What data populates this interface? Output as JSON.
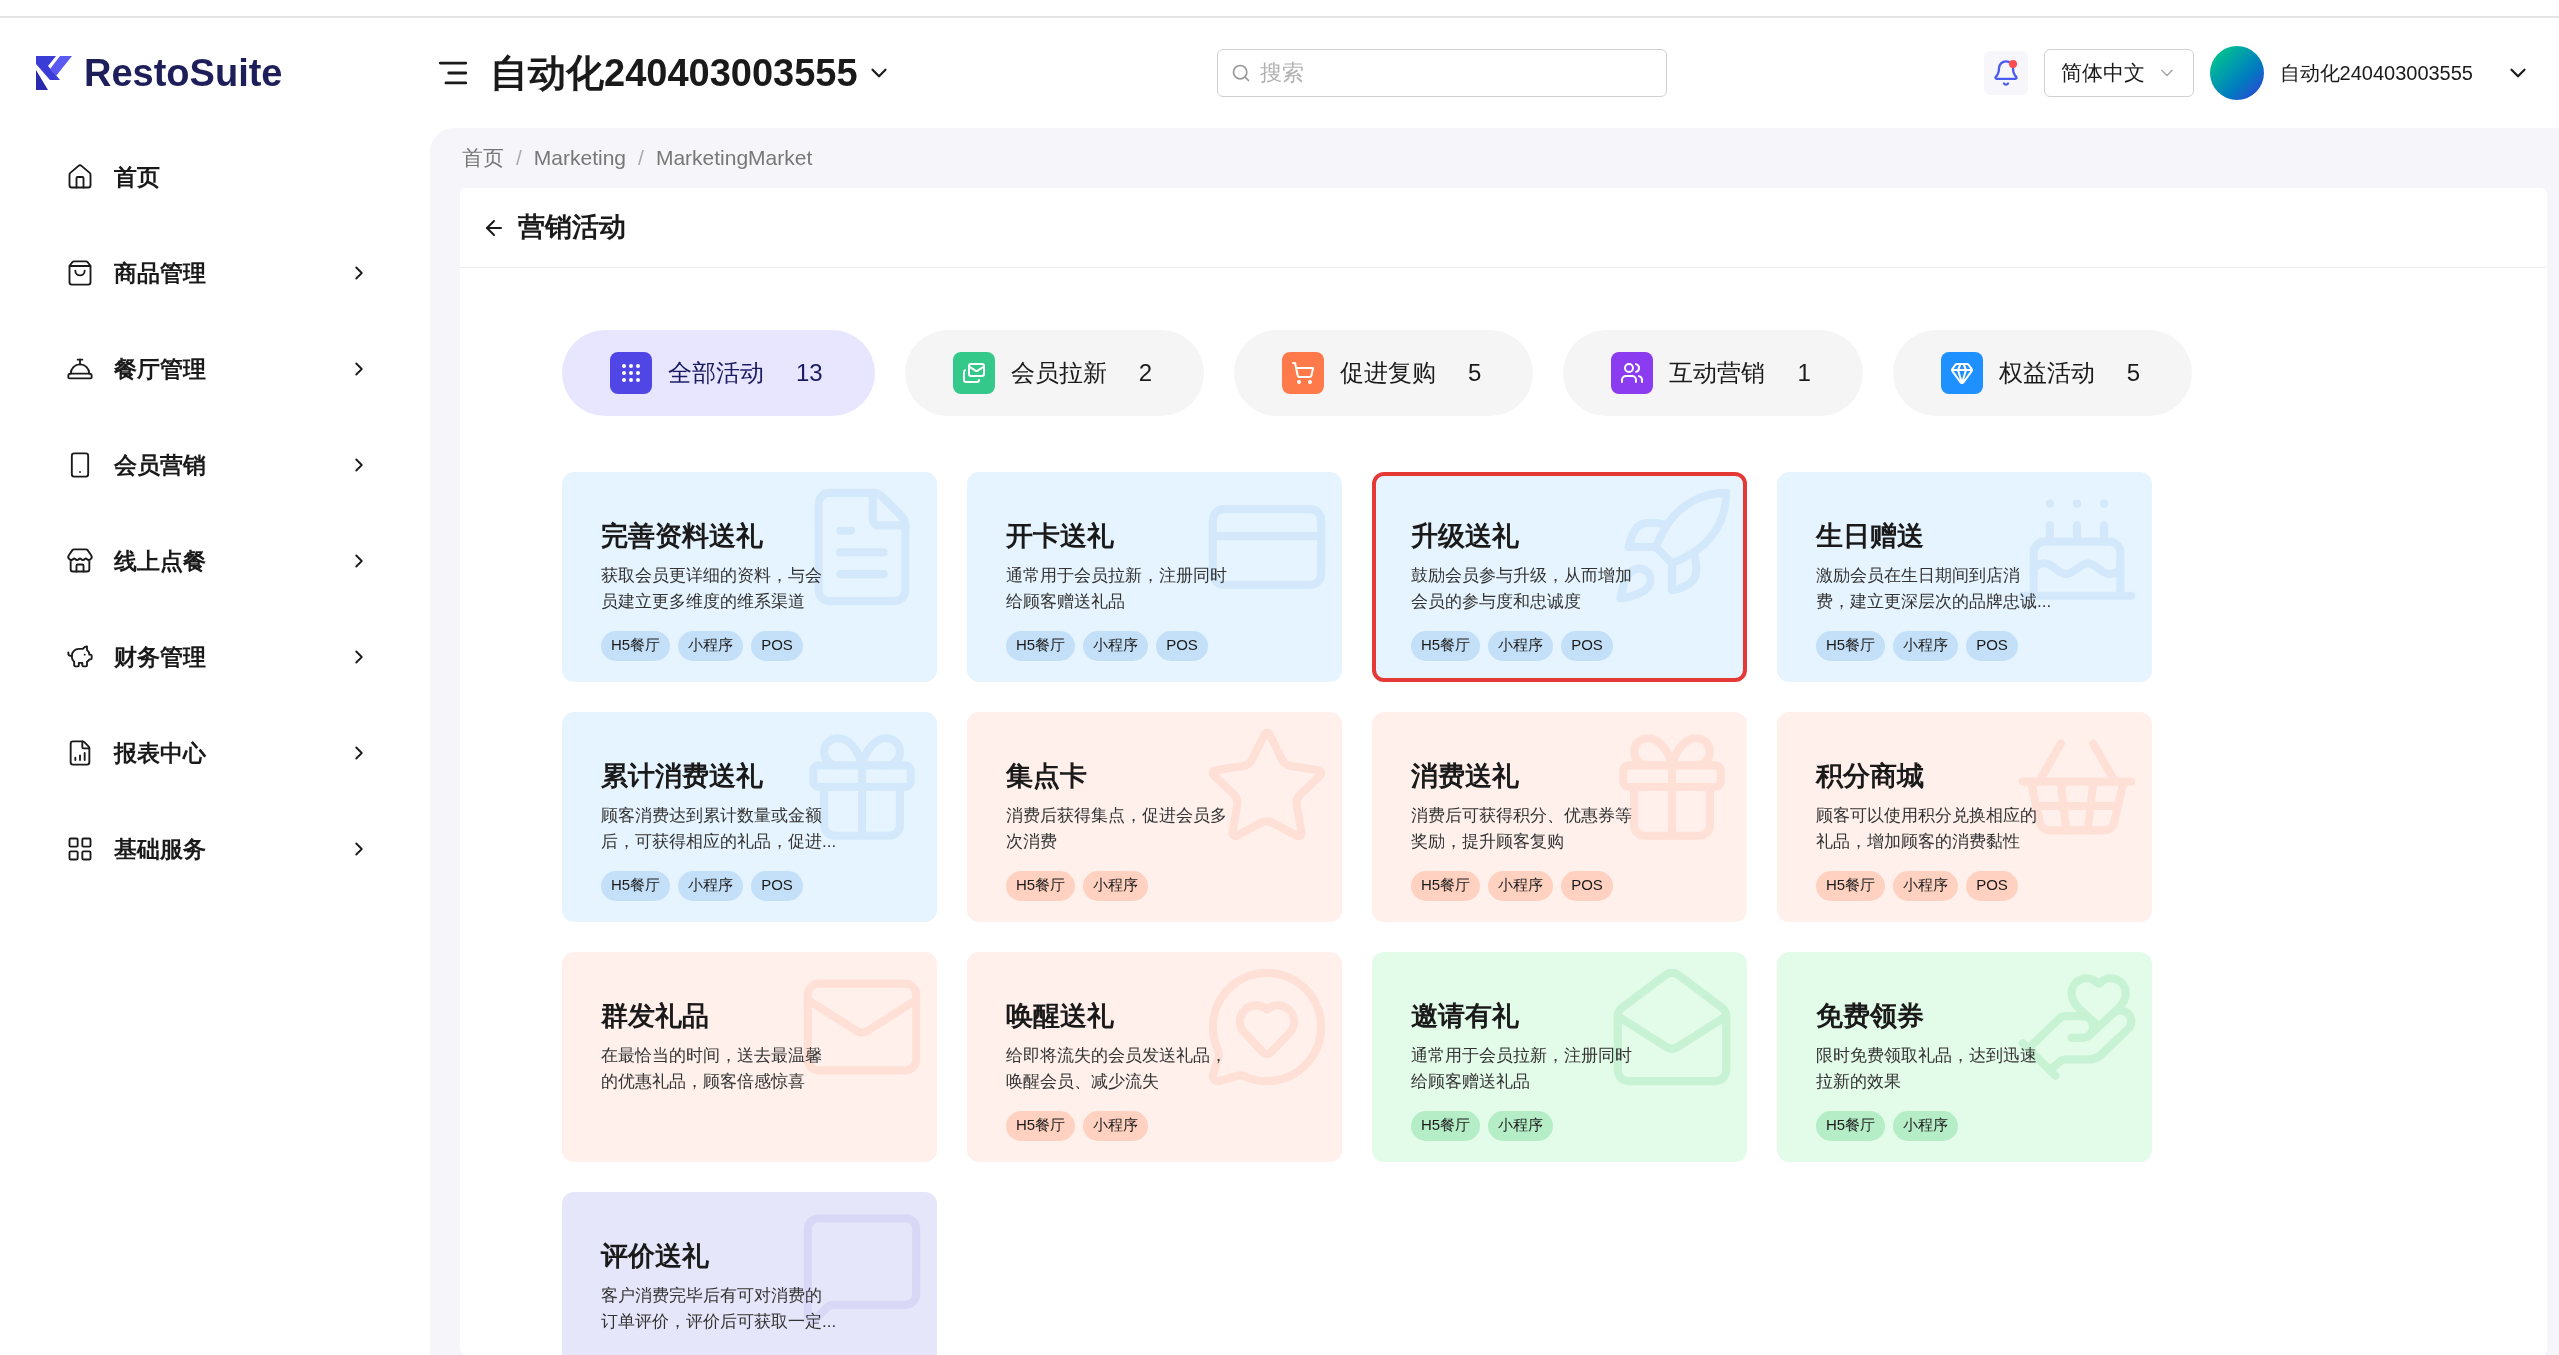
{
  "logo": "RestoSuite",
  "header": {
    "store": "自动化240403003555",
    "search": {
      "placeholder": "搜索"
    },
    "language": "简体中文",
    "user": "自动化240403003555",
    "notification_dot": true
  },
  "sidebar": {
    "items": [
      {
        "label": "首页",
        "has_children": false
      },
      {
        "label": "商品管理",
        "has_children": true
      },
      {
        "label": "餐厅管理",
        "has_children": true
      },
      {
        "label": "会员营销",
        "has_children": true
      },
      {
        "label": "线上点餐",
        "has_children": true
      },
      {
        "label": "财务管理",
        "has_children": true
      },
      {
        "label": "报表中心",
        "has_children": true
      },
      {
        "label": "基础服务",
        "has_children": true
      }
    ]
  },
  "breadcrumb": [
    {
      "kind": "link",
      "text": "首页"
    },
    {
      "kind": "separator",
      "text": "/"
    },
    {
      "kind": "link",
      "text": "Marketing"
    },
    {
      "kind": "separator",
      "text": "/"
    },
    {
      "kind": "link",
      "text": "MarketingMarket"
    }
  ],
  "page_title": "营销活动",
  "tabs": [
    {
      "label": "全部活动",
      "count": "13",
      "selected": true,
      "color": "#4f46e5"
    },
    {
      "label": "会员拉新",
      "count": "2",
      "selected": false,
      "color": "#34c98a"
    },
    {
      "label": "促进复购",
      "count": "5",
      "selected": false,
      "color": "#ff7a4a"
    },
    {
      "label": "互动营销",
      "count": "1",
      "selected": false,
      "color": "#8b3cf0"
    },
    {
      "label": "权益活动",
      "count": "5",
      "selected": false,
      "color": "#1e90ff"
    }
  ],
  "cards": [
    {
      "title": "完善资料送礼",
      "description": "获取会员更详细的资料，与会员建立更多维度的维系渠道",
      "tags": [
        "H5餐厅",
        "小程序",
        "POS"
      ],
      "color": "#e6f4ff",
      "selected": false
    },
    {
      "title": "开卡送礼",
      "description": "通常用于会员拉新，注册同时给顾客赠送礼品",
      "tags": [
        "H5餐厅",
        "小程序",
        "POS"
      ],
      "color": "#e6f4ff",
      "selected": false
    },
    {
      "title": "升级送礼",
      "description": "鼓励会员参与升级，从而增加会员的参与度和忠诚度",
      "tags": [
        "H5餐厅",
        "小程序",
        "POS"
      ],
      "color": "#e6f4ff",
      "selected": true
    },
    {
      "title": "生日赠送",
      "description": "激励会员在生日期间到店消费，建立更深层次的品牌忠诚...",
      "tags": [
        "H5餐厅",
        "小程序",
        "POS"
      ],
      "color": "#e6f4ff",
      "selected": false
    },
    {
      "title": "累计消费送礼",
      "description": "顾客消费达到累计数量或金额后，可获得相应的礼品，促进...",
      "tags": [
        "H5餐厅",
        "小程序",
        "POS"
      ],
      "color": "#e6f4ff",
      "selected": false
    },
    {
      "title": "集点卡",
      "description": "消费后获得集点，促进会员多次消费",
      "tags": [
        "H5餐厅",
        "小程序"
      ],
      "color": "#fff0eb",
      "selected": false
    },
    {
      "title": "消费送礼",
      "description": "消费后可获得积分、优惠券等奖励，提升顾客复购",
      "tags": [
        "H5餐厅",
        "小程序",
        "POS"
      ],
      "color": "#fff0eb",
      "selected": false
    },
    {
      "title": "积分商城",
      "description": "顾客可以使用积分兑换相应的礼品，增加顾客的消费黏性",
      "tags": [
        "H5餐厅",
        "小程序",
        "POS"
      ],
      "color": "#fff0eb",
      "selected": false
    },
    {
      "title": "群发礼品",
      "description": "在最恰当的时间，送去最温馨的优惠礼品，顾客倍感惊喜",
      "color": "#fff0eb",
      "selected": false
    },
    {
      "title": "唤醒送礼",
      "description": "给即将流失的会员发送礼品，唤醒会员、减少流失",
      "tags": [
        "H5餐厅",
        "小程序"
      ],
      "color": "#fff0eb",
      "selected": false
    },
    {
      "title": "邀请有礼",
      "description": "通常用于会员拉新，注册同时给顾客赠送礼品",
      "tags": [
        "H5餐厅",
        "小程序"
      ],
      "color": "#e3fbe9",
      "selected": false
    },
    {
      "title": "免费领券",
      "description": "限时免费领取礼品，达到迅速拉新的效果",
      "tags": [
        "H5餐厅",
        "小程序"
      ],
      "color": "#e3fbe9",
      "selected": false
    },
    {
      "title": "评价送礼",
      "description": "客户消费完毕后有可对消费的订单评价，评价后可获取一定...",
      "color": "#e6e6fa",
      "selected": false
    }
  ]
}
